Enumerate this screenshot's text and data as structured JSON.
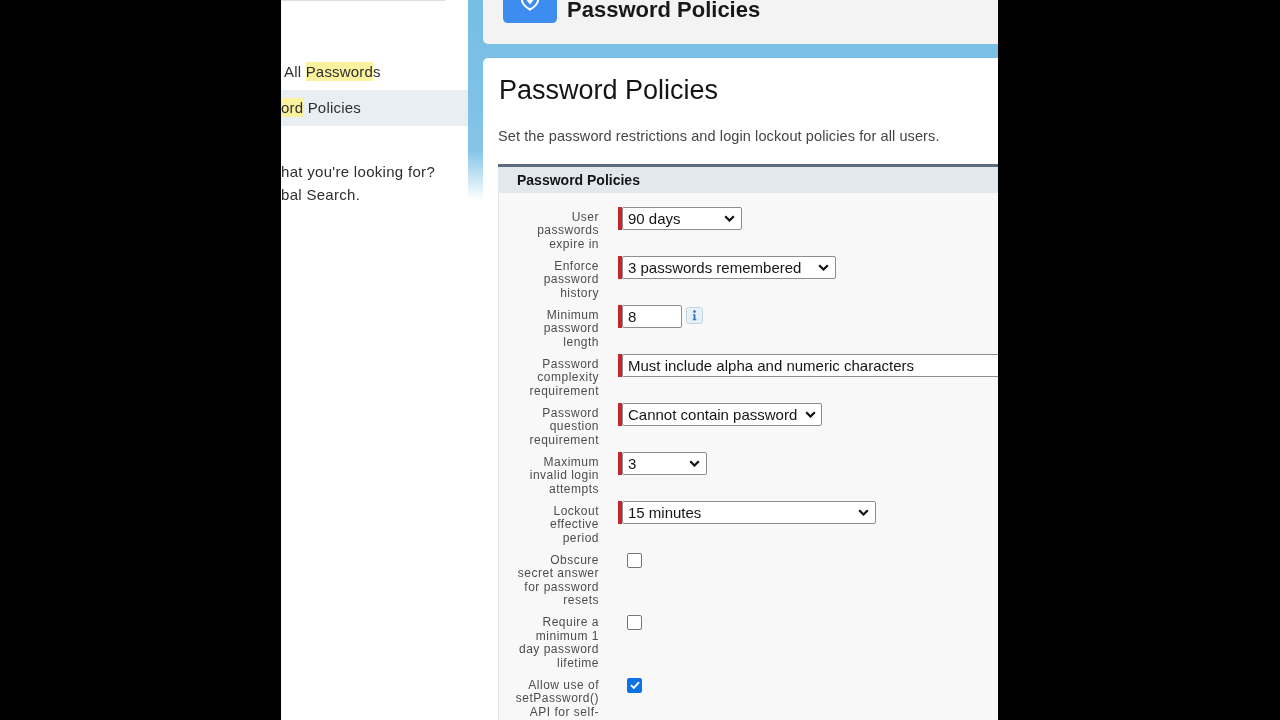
{
  "sidebar": {
    "items": [
      {
        "parts": [
          {
            "text": "All ",
            "highlighted": false
          },
          {
            "text": "Password",
            "highlighted": true
          },
          {
            "text": "s",
            "highlighted": false
          }
        ],
        "selected": false
      },
      {
        "parts": [
          {
            "text": "ord",
            "highlighted": true
          },
          {
            "text": " Policies",
            "highlighted": false
          }
        ],
        "selected": true
      }
    ],
    "help_lines": [
      "hat you're looking for?",
      "bal Search."
    ]
  },
  "header": {
    "title": "Password Policies"
  },
  "page": {
    "title": "Password Policies",
    "description": "Set the password restrictions and login lockout policies for all users."
  },
  "section": {
    "title": "Password Policies",
    "fields": [
      {
        "label": "User passwords expire in",
        "kind": "select",
        "value": "90 days",
        "required": true,
        "info": false
      },
      {
        "label": "Enforce password history",
        "kind": "select",
        "value": "3 passwords remembered",
        "required": true,
        "info": false
      },
      {
        "label": "Minimum password length",
        "kind": "text",
        "value": "8",
        "required": true,
        "info": true
      },
      {
        "label": "Password complexity requirement",
        "kind": "select",
        "value": "Must include alpha and numeric characters",
        "required": true,
        "info": false
      },
      {
        "label": "Password question requirement",
        "kind": "select",
        "value": "Cannot contain password",
        "required": true,
        "info": false
      },
      {
        "label": "Maximum invalid login attempts",
        "kind": "select",
        "value": "3",
        "required": true,
        "info": false
      },
      {
        "label": "Lockout effective period",
        "kind": "select",
        "value": "15 minutes",
        "required": true,
        "info": false
      },
      {
        "label": "Obscure secret answer for password resets",
        "kind": "checkbox",
        "checked": false,
        "required": false,
        "info": false
      },
      {
        "label": "Require a minimum 1 day password lifetime",
        "kind": "checkbox",
        "checked": false,
        "required": false,
        "info": false
      },
      {
        "label": "Allow use of setPassword() API for self-",
        "kind": "checkbox",
        "checked": true,
        "required": false,
        "info": false
      }
    ]
  }
}
